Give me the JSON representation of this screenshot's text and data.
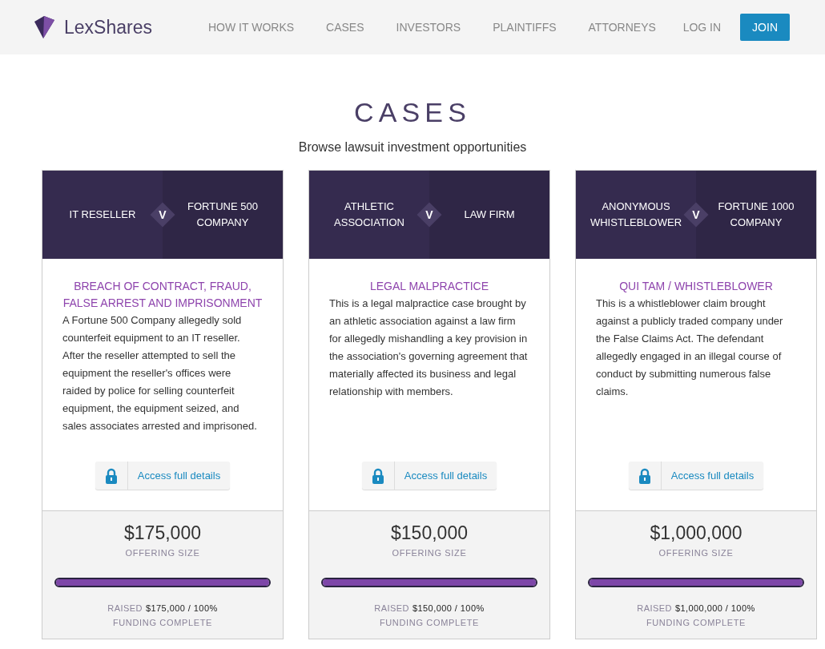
{
  "header": {
    "logo": "LexShares",
    "nav": [
      {
        "label": "HOW IT WORKS"
      },
      {
        "label": "CASES"
      },
      {
        "label": "INVESTORS"
      },
      {
        "label": "PLAINTIFFS"
      },
      {
        "label": "ATTORNEYS"
      }
    ],
    "login": "LOG IN",
    "join": "JOIN"
  },
  "page": {
    "title": "CASES",
    "subtitle": "Browse lawsuit investment opportunities"
  },
  "cases": [
    {
      "plaintiff": "IT RESELLER",
      "versus": "V",
      "defendant": "FORTUNE 500 COMPANY",
      "case_type": "BREACH OF CONTRACT, FRAUD, FALSE ARREST AND IMPRISONMENT",
      "description": "A Fortune 500 Company allegedly sold counterfeit equipment to an IT reseller. After the reseller attempted to sell the equipment the reseller's offices were raided by police for selling counterfeit equipment, the equipment seized, and sales associates arrested and imprisoned.",
      "details_link": "Access full details",
      "offering_size": "$175,000",
      "offering_label": "OFFERING SIZE",
      "level": 1,
      "raised_label": "RAISED",
      "raised_value": "$175,000 / 100%",
      "status": "FUNDING COMPLETE"
    },
    {
      "plaintiff": "ATHLETIC ASSOCIATION",
      "versus": "V",
      "defendant": "LAW FIRM",
      "case_type": "LEGAL MALPRACTICE",
      "description": "This is a legal malpractice case brought by an athletic association against a law firm for allegedly mishandling a key provision in the association's governing agreement that materially affected its business and legal relationship with members.",
      "details_link": "Access full details",
      "offering_size": "$150,000",
      "offering_label": "OFFERING SIZE",
      "level": 1,
      "raised_label": "RAISED",
      "raised_value": "$150,000 / 100%",
      "status": "FUNDING COMPLETE"
    },
    {
      "plaintiff": "ANONYMOUS WHISTLEBLOWER",
      "versus": "V",
      "defendant": "FORTUNE 1000 COMPANY",
      "case_type": "QUI TAM / WHISTLEBLOWER",
      "description": "This is a whistleblower claim brought against a publicly traded company under the False Claims Act. The defendant allegedly engaged in an illegal course of conduct by submitting numerous false claims.",
      "details_link": "Access full details",
      "offering_size": "$1,000,000",
      "offering_label": "OFFERING SIZE",
      "level": 1,
      "raised_label": "RAISED",
      "raised_value": "$1,000,000 / 100%",
      "status": "FUNDING COMPLETE"
    }
  ]
}
